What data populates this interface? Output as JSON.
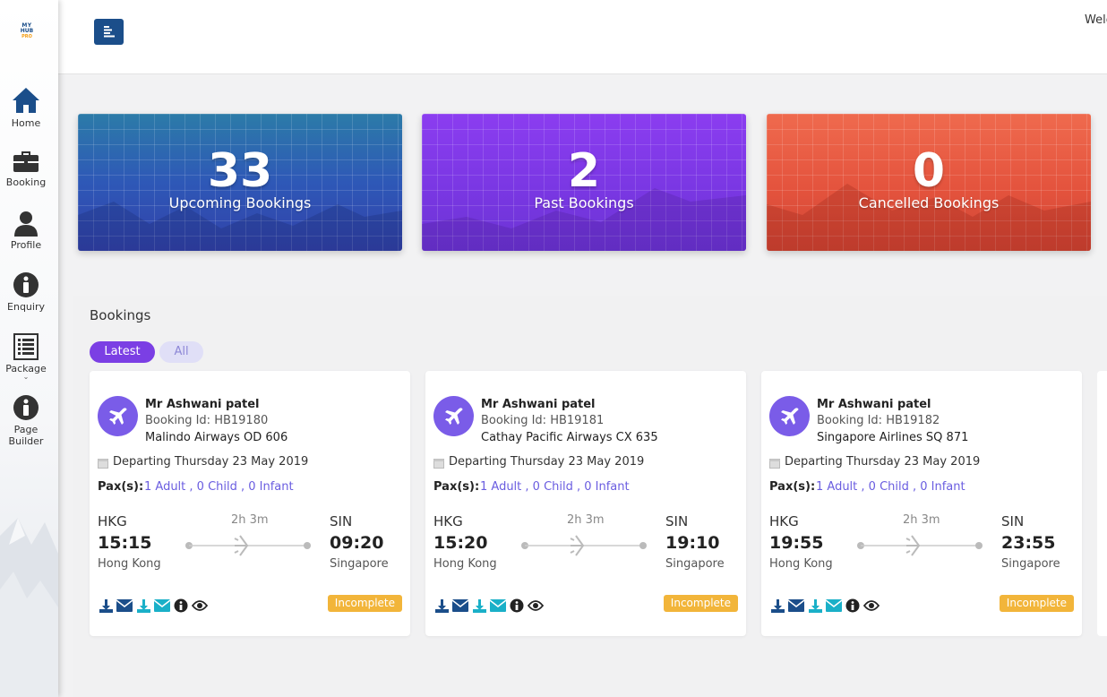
{
  "app": {
    "logo_lines": [
      "MY",
      "HUB",
      "PRO"
    ],
    "welcome": "Welcome"
  },
  "sidebar": {
    "items": [
      {
        "label": "Home",
        "icon": "home-icon"
      },
      {
        "label": "Booking",
        "icon": "briefcase-icon"
      },
      {
        "label": "Profile",
        "icon": "user-icon"
      },
      {
        "label": "Enquiry",
        "icon": "info-icon"
      },
      {
        "label": "Package",
        "icon": "list-icon"
      },
      {
        "label": "Page\nBuilder",
        "icon": "info-icon"
      }
    ]
  },
  "stats": [
    {
      "value": "33",
      "label": "Upcoming Bookings",
      "color": "#2e58b7"
    },
    {
      "value": "2",
      "label": "Past Bookings",
      "color": "#7a37e3"
    },
    {
      "value": "0",
      "label": "Cancelled Bookings",
      "color": "#e4533d"
    }
  ],
  "bookings": {
    "title": "Bookings",
    "tabs": [
      {
        "label": "Latest",
        "active": true
      },
      {
        "label": "All",
        "active": false
      }
    ],
    "cards": [
      {
        "name": "Mr Ashwani patel",
        "booking_id": "Booking Id: HB19180",
        "airline": "Malindo Airways OD 606",
        "departing": "Departing Thursday 23 May 2019",
        "pax_label": "Pax(s):",
        "pax": "1 Adult , 0 Child , 0 Infant",
        "from_code": "HKG",
        "from_time": "15:15",
        "from_city": "Hong Kong",
        "duration": "2h 3m",
        "to_code": "SIN",
        "to_time": "09:20",
        "to_city": "Singapore",
        "status": "Incomplete"
      },
      {
        "name": "Mr Ashwani patel",
        "booking_id": "Booking Id: HB19181",
        "airline": "Cathay Pacific Airways CX 635",
        "departing": "Departing Thursday 23 May 2019",
        "pax_label": "Pax(s):",
        "pax": "1 Adult , 0 Child , 0 Infant",
        "from_code": "HKG",
        "from_time": "15:20",
        "from_city": "Hong Kong",
        "duration": "2h 3m",
        "to_code": "SIN",
        "to_time": "19:10",
        "to_city": "Singapore",
        "status": "Incomplete"
      },
      {
        "name": "Mr Ashwani patel",
        "booking_id": "Booking Id: HB19182",
        "airline": "Singapore Airlines SQ 871",
        "departing": "Departing Thursday 23 May 2019",
        "pax_label": "Pax(s):",
        "pax": "1 Adult , 0 Child , 0 Infant",
        "from_code": "HKG",
        "from_time": "19:55",
        "from_city": "Hong Kong",
        "duration": "2h 3m",
        "to_code": "SIN",
        "to_time": "23:55",
        "to_city": "Singapore",
        "status": "Incomplete"
      }
    ],
    "action_icons": [
      "download-icon",
      "email-icon",
      "download-icon",
      "email-icon",
      "info-icon",
      "eye-icon"
    ]
  },
  "colors": {
    "brand": "#1b4e8a",
    "accent": "#7b3fe4",
    "status_incomplete": "#f2b53a",
    "action_blue": "#1b4e8a",
    "action_teal": "#1ab0c8"
  }
}
